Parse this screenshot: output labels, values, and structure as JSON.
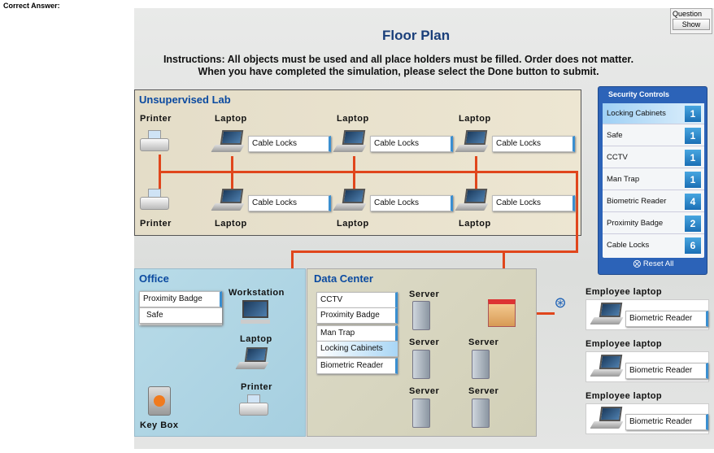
{
  "header": {
    "label": "Correct Answer:"
  },
  "question": {
    "label": "Question",
    "button": "Show"
  },
  "title": "Floor Plan",
  "instructions": [
    "Instructions: All objects must be used and all place holders must be filled. Order does not matter.",
    "When you have completed the simulation, please select the Done button to submit."
  ],
  "lab": {
    "label": "Unsupervised Lab",
    "printer": "Printer",
    "laptop": "Laptop",
    "slots": [
      "Cable Locks",
      "Cable Locks",
      "Cable Locks",
      "Cable Locks",
      "Cable Locks",
      "Cable Locks"
    ]
  },
  "office": {
    "label": "Office",
    "slots": [
      "Proximity Badge",
      "Safe"
    ],
    "workstation": "Workstation",
    "laptop": "Laptop",
    "printer": "Printer",
    "keybox": "Key Box"
  },
  "datacenter": {
    "label": "Data Center",
    "slots": [
      "CCTV",
      "Proximity Badge",
      "Man Trap",
      "Locking Cabinets",
      "Biometric Reader"
    ],
    "server": "Server"
  },
  "security_controls": {
    "title": "Security Controls",
    "items": [
      {
        "label": "Locking Cabinets",
        "count": "1",
        "selected": true
      },
      {
        "label": "Safe",
        "count": "1"
      },
      {
        "label": "CCTV",
        "count": "1"
      },
      {
        "label": "Man Trap",
        "count": "1"
      },
      {
        "label": "Biometric Reader",
        "count": "4"
      },
      {
        "label": "Proximity Badge",
        "count": "2"
      },
      {
        "label": "Cable Locks",
        "count": "6"
      }
    ],
    "reset": "Reset  All"
  },
  "employee": {
    "label": "Employee laptop",
    "slots": [
      "Biometric Reader",
      "Biometric Reader",
      "Biometric Reader"
    ]
  },
  "colors": {
    "wire": "#e0461c",
    "accent": "#2c63b8"
  }
}
